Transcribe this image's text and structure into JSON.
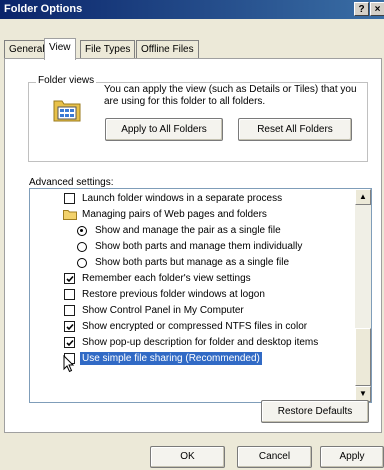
{
  "window": {
    "title": "Folder Options",
    "help_label": "?",
    "close_label": "×"
  },
  "tabs": [
    {
      "label": "General"
    },
    {
      "label": "View"
    },
    {
      "label": "File Types"
    },
    {
      "label": "Offline Files"
    }
  ],
  "folder_views": {
    "group_label": "Folder views",
    "description": "You can apply the view (such as Details or Tiles) that you are using for this folder to all folders.",
    "apply_button": "Apply to All Folders",
    "reset_button": "Reset All Folders"
  },
  "advanced": {
    "label": "Advanced settings:",
    "items": [
      {
        "type": "checkbox",
        "checked": false,
        "label": "Launch folder windows in a separate process"
      },
      {
        "type": "folder",
        "label": "Managing pairs of Web pages and folders"
      },
      {
        "type": "radio",
        "checked": true,
        "label": "Show and manage the pair as a single file"
      },
      {
        "type": "radio",
        "checked": false,
        "label": "Show both parts and manage them individually"
      },
      {
        "type": "radio",
        "checked": false,
        "label": "Show both parts but manage as a single file"
      },
      {
        "type": "checkbox",
        "checked": true,
        "label": "Remember each folder's view settings"
      },
      {
        "type": "checkbox",
        "checked": false,
        "label": "Restore previous folder windows at logon"
      },
      {
        "type": "checkbox",
        "checked": false,
        "label": "Show Control Panel in My Computer"
      },
      {
        "type": "checkbox",
        "checked": true,
        "label": "Show encrypted or compressed NTFS files in color"
      },
      {
        "type": "checkbox",
        "checked": true,
        "label": "Show pop-up description for folder and desktop items"
      },
      {
        "type": "checkbox",
        "checked": false,
        "label": "Use simple file sharing (Recommended)"
      }
    ],
    "restore_defaults_button": "Restore Defaults"
  },
  "footer": {
    "ok": "OK",
    "cancel": "Cancel",
    "apply": "Apply"
  }
}
